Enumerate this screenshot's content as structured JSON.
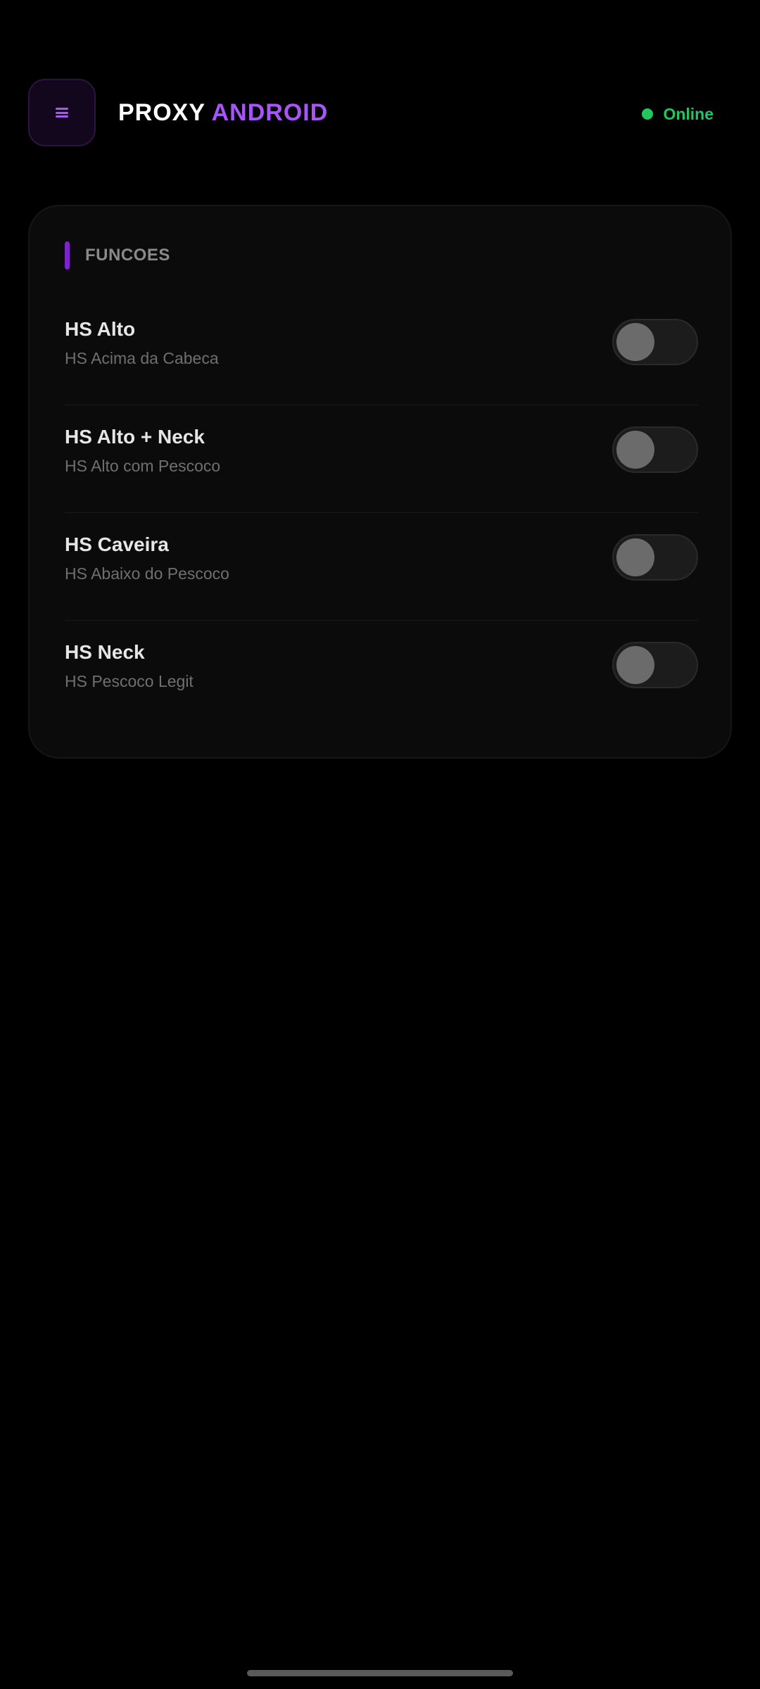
{
  "header": {
    "brand_first": "PROXY",
    "brand_second": "ANDROID",
    "menu_icon": "hamburger-menu-icon",
    "status_label": "Online",
    "status_color": "#22c55e",
    "accent_color": "#a855f7"
  },
  "section": {
    "title": "FUNCOES"
  },
  "features": [
    {
      "name": "HS Alto",
      "description": "HS Acima da Cabeca",
      "enabled": false
    },
    {
      "name": "HS Alto + Neck",
      "description": "HS Alto com Pescoco",
      "enabled": false
    },
    {
      "name": "HS Caveira",
      "description": "HS Abaixo do Pescoco",
      "enabled": false
    },
    {
      "name": "HS Neck",
      "description": "HS Pescoco Legit",
      "enabled": false
    }
  ]
}
